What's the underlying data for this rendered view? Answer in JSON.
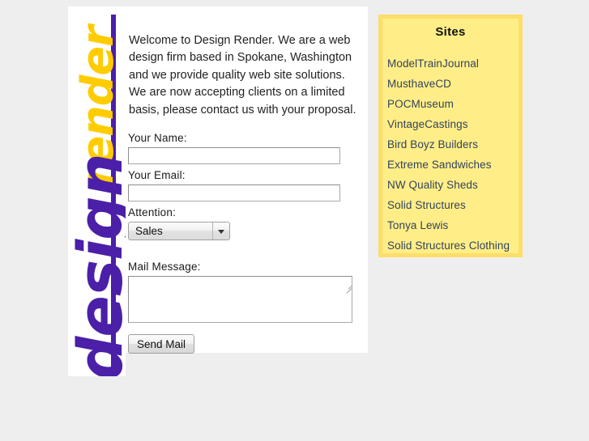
{
  "logo": {
    "top_word": "render",
    "bottom_word": "design",
    "purple": "#4b1fa8",
    "gold": "#ffcc00"
  },
  "main": {
    "welcome_text": "Welcome to Design Render. We are a web design firm based in Spokane, Washington and we provide quality web site solutions. We are now accepting clients on a limited basis, please contact us with your proposal.",
    "form": {
      "name_label": "Your Name:",
      "name_value": "",
      "email_label": "Your Email:",
      "email_value": "",
      "attention_label": "Attention:",
      "attention_value": "Sales",
      "message_label": "Mail Message:",
      "message_value": "",
      "submit_label": "Send Mail"
    }
  },
  "sidebar": {
    "heading": "Sites",
    "background": "#ffee88",
    "border": "#fcde68",
    "link_color": "#33425b",
    "links": [
      {
        "label": "ModelTrainJournal"
      },
      {
        "label": "MusthaveCD"
      },
      {
        "label": "POCMuseum"
      },
      {
        "label": "VintageCastings"
      },
      {
        "label": "Bird Boyz Builders"
      },
      {
        "label": "Extreme Sandwiches"
      },
      {
        "label": "NW Quality Sheds"
      },
      {
        "label": "Solid Structures"
      },
      {
        "label": "Tonya Lewis"
      },
      {
        "label": "Solid Structures Clothing"
      }
    ]
  },
  "page": {
    "background": "#eeeeee"
  }
}
